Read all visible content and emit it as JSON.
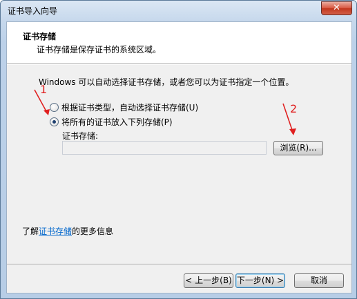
{
  "window": {
    "title": "证书导入向导",
    "close_label": "✕"
  },
  "header": {
    "title": "证书存储",
    "subtitle": "证书存储是保存证书的系统区域。"
  },
  "body": {
    "description": "Windows 可以自动选择证书存储，或者您可以为证书指定一个位置。",
    "options": [
      {
        "label": "根据证书类型，自动选择证书存储(U)",
        "checked": false
      },
      {
        "label": "将所有的证书放入下列存储(P)",
        "checked": true
      }
    ],
    "store_label": "证书存储:",
    "store_value": "",
    "browse_label": "浏览(R)..."
  },
  "learn_more": {
    "prefix": "了解",
    "link": "证书存储",
    "suffix": "的更多信息"
  },
  "footer": {
    "back_label": "< 上一步(B)",
    "next_label": "下一步(N) >",
    "cancel_label": "取消"
  },
  "annotations": {
    "marker_1": "1",
    "marker_2": "2"
  },
  "colors": {
    "annotation": "#e02020",
    "link": "#0066cc"
  }
}
